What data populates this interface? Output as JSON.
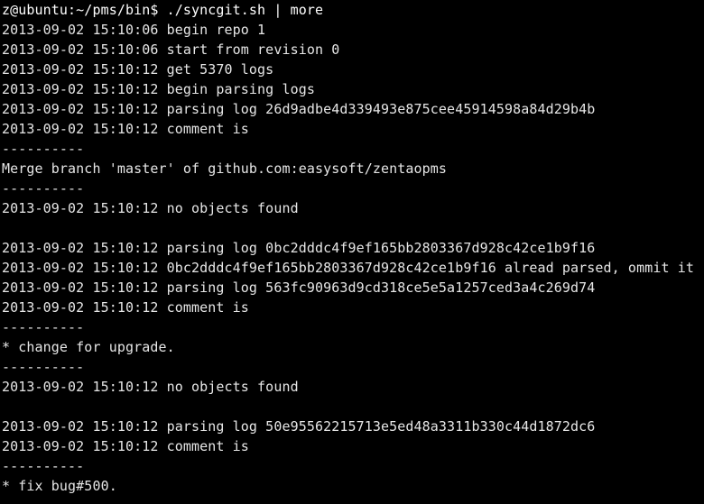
{
  "terminal": {
    "app": "terminal-window",
    "colors": {
      "background": "#000000",
      "foreground": "#e6e6e6",
      "prompt": "#ffffff"
    },
    "prompt": {
      "user_host_path": "z@ubuntu:~/pms/bin$",
      "command": "./syncgit.sh | more",
      "full": "z@ubuntu:~/pms/bin$ ./syncgit.sh | more"
    },
    "separator": "----------",
    "lines": [
      {
        "type": "prompt",
        "text": "z@ubuntu:~/pms/bin$ ./syncgit.sh | more"
      },
      {
        "type": "log",
        "text": "2013-09-02 15:10:06 begin repo 1"
      },
      {
        "type": "log",
        "text": "2013-09-02 15:10:06 start from revision 0"
      },
      {
        "type": "log",
        "text": "2013-09-02 15:10:12 get 5370 logs"
      },
      {
        "type": "log",
        "text": "2013-09-02 15:10:12 begin parsing logs"
      },
      {
        "type": "log",
        "text": "2013-09-02 15:10:12 parsing log 26d9adbe4d339493e875cee45914598a84d29b4b"
      },
      {
        "type": "log",
        "text": "2013-09-02 15:10:12 comment is"
      },
      {
        "type": "sep",
        "text": "----------"
      },
      {
        "type": "comment",
        "text": "Merge branch 'master' of github.com:easysoft/zentaopms"
      },
      {
        "type": "sep",
        "text": "----------"
      },
      {
        "type": "log",
        "text": "2013-09-02 15:10:12 no objects found"
      },
      {
        "type": "blank",
        "text": ""
      },
      {
        "type": "log",
        "text": "2013-09-02 15:10:12 parsing log 0bc2dddc4f9ef165bb2803367d928c42ce1b9f16"
      },
      {
        "type": "log",
        "text": "2013-09-02 15:10:12 0bc2dddc4f9ef165bb2803367d928c42ce1b9f16 alread parsed, ommit it"
      },
      {
        "type": "log",
        "text": "2013-09-02 15:10:12 parsing log 563fc90963d9cd318ce5e5a1257ced3a4c269d74"
      },
      {
        "type": "log",
        "text": "2013-09-02 15:10:12 comment is"
      },
      {
        "type": "sep",
        "text": "----------"
      },
      {
        "type": "comment",
        "text": "* change for upgrade."
      },
      {
        "type": "sep",
        "text": "----------"
      },
      {
        "type": "log",
        "text": "2013-09-02 15:10:12 no objects found"
      },
      {
        "type": "blank",
        "text": ""
      },
      {
        "type": "log",
        "text": "2013-09-02 15:10:12 parsing log 50e95562215713e5ed48a3311b330c44d1872dc6"
      },
      {
        "type": "log",
        "text": "2013-09-02 15:10:12 comment is"
      },
      {
        "type": "sep",
        "text": "----------"
      },
      {
        "type": "comment",
        "text": "* fix bug#500."
      }
    ],
    "hashes": [
      "26d9adbe4d339493e875cee45914598a84d29b4b",
      "0bc2dddc4f9ef165bb2803367d928c42ce1b9f16",
      "563fc90963d9cd318ce5e5a1257ced3a4c269d74",
      "50e95562215713e5ed48a3311b330c44d1872dc6"
    ],
    "timestamps": [
      "2013-09-02 15:10:06",
      "2013-09-02 15:10:12"
    ]
  }
}
